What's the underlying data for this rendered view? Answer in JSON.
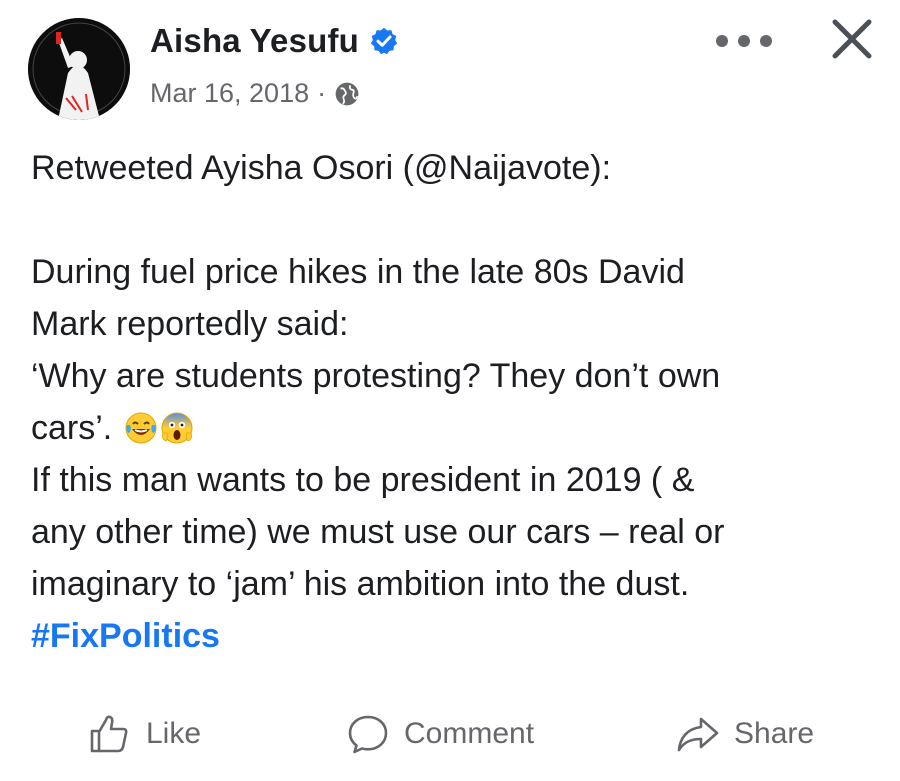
{
  "post": {
    "author": "Aisha Yesufu",
    "timestamp": "Mar 16, 2018",
    "separator": "·",
    "lines": {
      "retweet": "Retweeted Ayisha Osori (@Naijavote):",
      "l1": "During fuel price hikes in the late 80s  David",
      "l2": "Mark reportedly said:",
      "l3": "‘Why are students protesting? They don’t own",
      "l4": "cars’.",
      "l5": "If this man wants to be president in 2019 ( &",
      "l6": "any other time) we must use our cars – real or",
      "l7": "imaginary to ‘jam’ his ambition into the dust."
    },
    "hashtag": "#FixPolitics"
  },
  "icons": {
    "verified": "verified-badge-icon",
    "audience": "globe-icon",
    "more": "more-options-icon",
    "close": "close-icon",
    "emoji1": "laughing-tears-emoji",
    "emoji2": "screaming-face-emoji"
  },
  "actions": {
    "like": "Like",
    "comment": "Comment",
    "share": "Share"
  },
  "colors": {
    "text": "#1c1e21",
    "secondary": "#65676b",
    "link": "#1877f2",
    "verified": "#1877f2"
  }
}
